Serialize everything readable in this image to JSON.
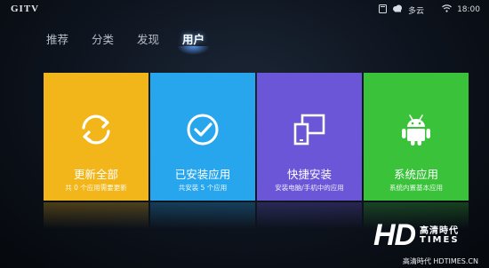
{
  "header": {
    "logo": "GITV",
    "weather": "多云",
    "time": "18:00"
  },
  "tabs": [
    {
      "label": "推荐"
    },
    {
      "label": "分类"
    },
    {
      "label": "发现"
    },
    {
      "label": "用户",
      "active": true
    }
  ],
  "tiles": [
    {
      "title": "更新全部",
      "subtitle": "共 0 个应用需要更新",
      "color": "#f2b61a",
      "icon": "refresh-icon"
    },
    {
      "title": "已安装应用",
      "subtitle": "共安装 5 个应用",
      "color": "#27a6ee",
      "icon": "checkmark-icon"
    },
    {
      "title": "快捷安装",
      "subtitle": "安装电脑/手机中的应用",
      "color": "#6a56d6",
      "icon": "devices-icon"
    },
    {
      "title": "系统应用",
      "subtitle": "系统内置基本应用",
      "color": "#39c23a",
      "icon": "android-icon"
    }
  ],
  "watermark": {
    "hd": "HD",
    "name_cn": "高清時代",
    "name_en": "TIMES",
    "url": "高清時代 HDTIMES.CN"
  }
}
